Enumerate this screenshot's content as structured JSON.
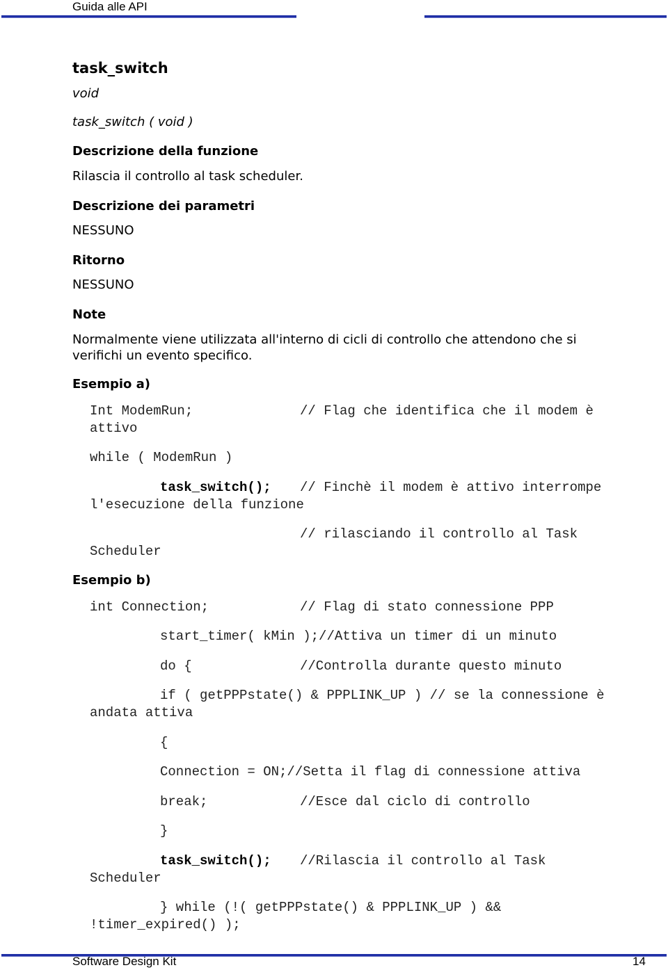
{
  "header": {
    "title": "Guida alle API"
  },
  "function": {
    "name": "task_switch",
    "return_type": "void",
    "signature": "task_switch ( void )"
  },
  "sections": {
    "description_heading": "Descrizione della funzione",
    "description_text": "Rilascia il controllo al task scheduler.",
    "params_heading": "Descrizione dei parametri",
    "params_text": "NESSUNO",
    "return_heading": "Ritorno",
    "return_text": "NESSUNO",
    "note_heading": "Note",
    "note_text": "Normalmente viene utilizzata all'interno di cicli di controllo che attendono che si verifichi un evento specifico."
  },
  "example_a": {
    "heading": "Esempio a)",
    "lines": [
      {
        "code": "Int ModemRun;",
        "comment": "// Flag che identifica che il modem è"
      },
      {
        "code": "attivo"
      },
      {
        "code": "while ( ModemRun )"
      },
      {
        "code_bold": "task_switch();",
        "comment": "// Finchè il modem è attivo interrompe"
      },
      {
        "code": "l'esecuzione della funzione"
      },
      {
        "comment": "// rilasciando il controllo al Task"
      },
      {
        "code": "Scheduler"
      }
    ]
  },
  "example_b": {
    "heading": "Esempio b)",
    "lines": [
      {
        "code": "int Connection;",
        "comment": "// Flag di stato connessione PPP"
      },
      {
        "code": "start_timer( kMin );//Attiva un timer di un minuto"
      },
      {
        "code": "do {",
        "comment": "//Controlla durante questo minuto"
      },
      {
        "code": "if ( getPPPstate() & PPPLINK_UP ) // se la connessione è"
      },
      {
        "code": "andata attiva"
      },
      {
        "code": "{"
      },
      {
        "code": "Connection = ON;//Setta il flag di connessione attiva"
      },
      {
        "code": "break;",
        "comment": "//Esce dal ciclo di controllo"
      },
      {
        "code": "}"
      },
      {
        "code_bold": "task_switch();",
        "comment": "//Rilascia il controllo al Task"
      },
      {
        "code": "Scheduler"
      },
      {
        "code": "} while (!( getPPPstate() & PPPLINK_UP ) &&"
      },
      {
        "code": "!timer_expired() );"
      }
    ]
  },
  "footer": {
    "title": "Software Design Kit",
    "page_number": "14"
  },
  "colors": {
    "rule": "#1f2fa6"
  }
}
